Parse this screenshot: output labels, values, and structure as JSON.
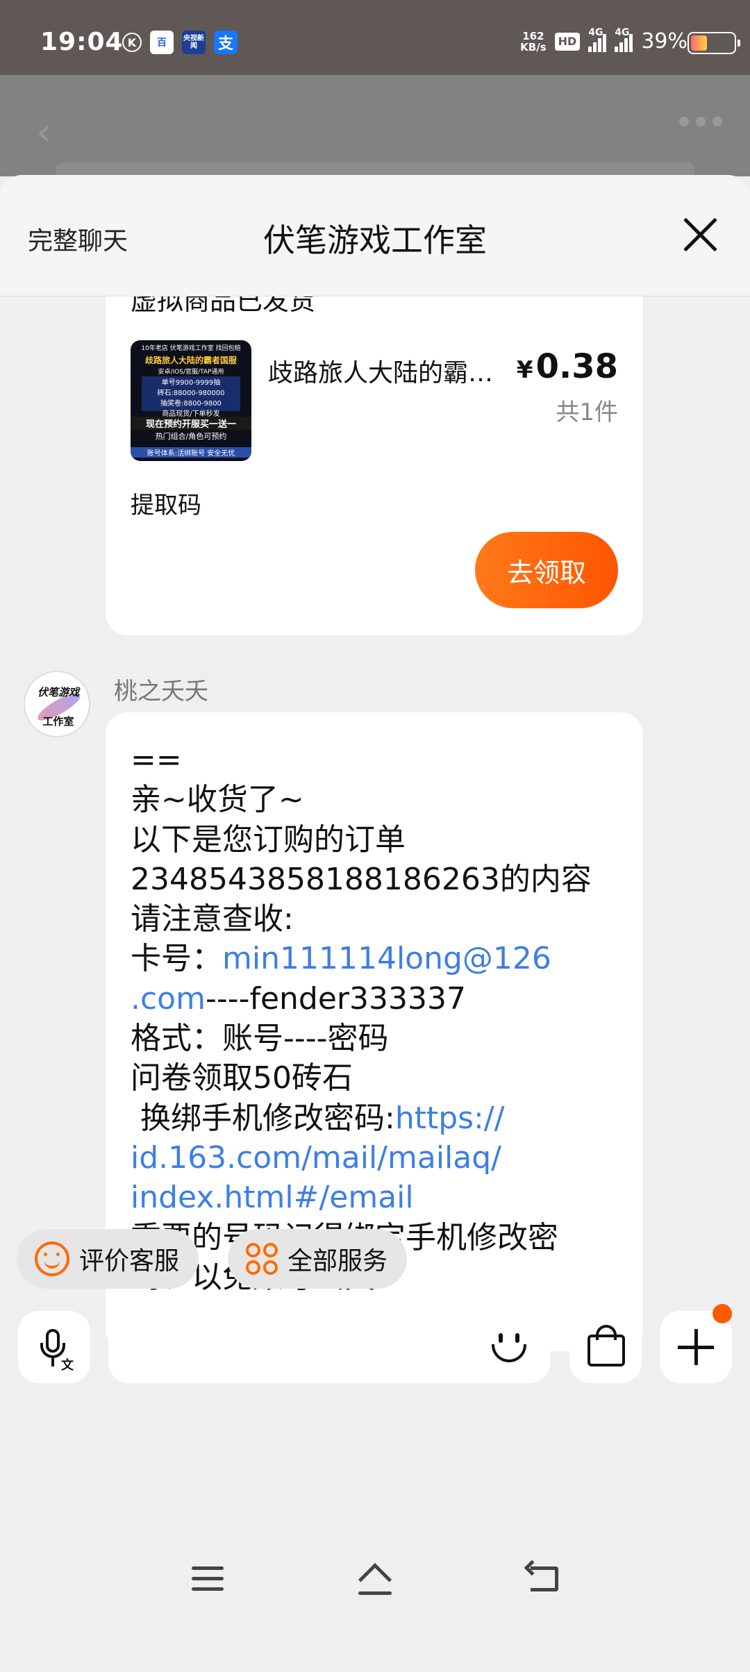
{
  "status_bar": {
    "time": "19:04",
    "k_badge": "K",
    "baidu_glyph": "百",
    "cctv_label": "央视新闻",
    "alipay_glyph": "支",
    "net_speed_value": "162",
    "net_speed_unit": "KB/s",
    "hd_label": "HD",
    "signal_1": "4G",
    "signal_2": "4G",
    "battery_percent": "39%",
    "battery_level": 0.39
  },
  "sheet": {
    "full_chat_label": "完整聊天",
    "title": "伏笔游戏工作室"
  },
  "order_card": {
    "status_text": "虚拟商品已发货",
    "product_image_text": {
      "line1": "10年老店 伏笔游戏工作室 找回包赔",
      "line2": "歧路旅人大陆的霸者国服",
      "line3": "安卓/IOS/官服/TAP通用",
      "line4": "单号9900-9999抽\n砖石:88000-980000\n抽奖卷:8800-9800\n商品现货/下单秒发",
      "line5": "现在预约开服买一送一",
      "line6": "热门组合/角色可预约",
      "line7": "账号体系:活绑账号 安全无忧"
    },
    "product_name": "歧路旅人大陆的霸…",
    "currency": "¥",
    "price": "0.38",
    "count_text": "共1件",
    "pickup_label": "提取码",
    "claim_button": "去领取"
  },
  "message": {
    "avatar_text_top": "伏笔游戏",
    "avatar_text_bottom": "工作室",
    "sender_name": "桃之夭夭",
    "lines": {
      "l1": "==",
      "l2": "亲~收货了~",
      "l3": "以下是您订购的订单",
      "l4": "2348543858188186263的内容",
      "l5": "请注意查收:",
      "l6_prefix": "卡号：",
      "l6_link": "min111114long@126",
      "l7_link": ".com",
      "l7_rest": "----fender333337",
      "l8": "格式：账号----密码",
      "l9": "问卷领取50砖石",
      "l10_prefix": " 换绑手机修改密码:",
      "l10_link": "https://",
      "l11_link": "id.163.com/mail/mailaq/",
      "l12_link": "index.html#/email",
      "l13": "重要的号码记得绑定手机修改密",
      "l14": "码、以免账号丢失",
      "l15": "=="
    }
  },
  "quick_actions": {
    "rate_service": "评价客服",
    "all_services": "全部服务"
  },
  "input_bar": {
    "voice_label_glyph": "文"
  }
}
